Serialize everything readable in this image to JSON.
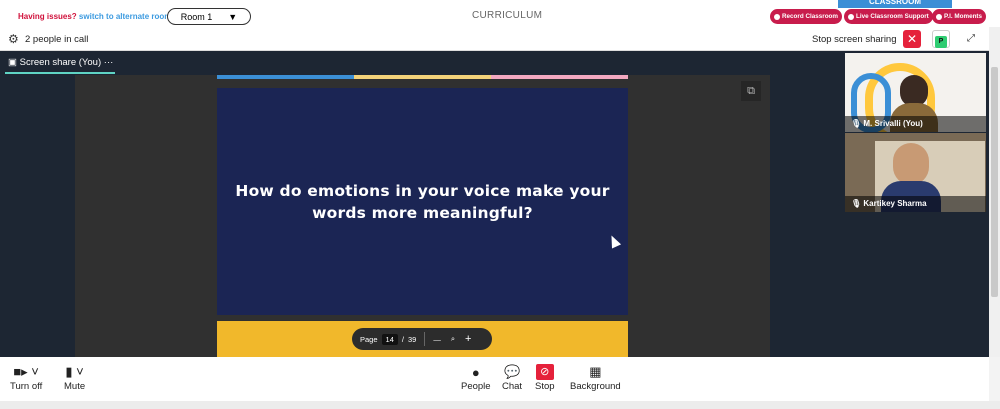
{
  "top": {
    "issue_text": "Having issues?",
    "issue_link": "switch to alternate room",
    "room": "Room 1",
    "room_caret": "▼",
    "title": "CURRICULUM",
    "logo_text": "CLASSROOM",
    "record": "Record Classroom",
    "support": "Live Classroom Support",
    "moments": "P.I. Moments"
  },
  "callbar": {
    "people_in_call": "2 people in call",
    "stop_sharing": "Stop screen sharing",
    "close": "✕",
    "avatar_letter": "P",
    "expand": "⤢"
  },
  "stage": {
    "tab_label": "Screen share (You)",
    "tab_more": "···",
    "slide_text_1": "How do emotions in your voice make your",
    "slide_text_2": "words more meaningful?",
    "page_label": "Page",
    "page_current": "14",
    "page_sep": "/",
    "page_total": "39",
    "zoom_out": "—",
    "zoom_icon": "⌕",
    "zoom_in": "+"
  },
  "participants": [
    {
      "name": "M. Srivalli (You)"
    },
    {
      "name": "Kartikey Sharma"
    }
  ],
  "controls": {
    "camera": "Turn off",
    "mic": "Mute",
    "people": "People",
    "chat": "Chat",
    "stop": "Stop",
    "background": "Background"
  },
  "colors": {
    "accent_red": "#c81c4c",
    "slide_bg": "#1b2554",
    "slide_band": "#f1b82b",
    "active_tab": "#5fd4c4"
  }
}
